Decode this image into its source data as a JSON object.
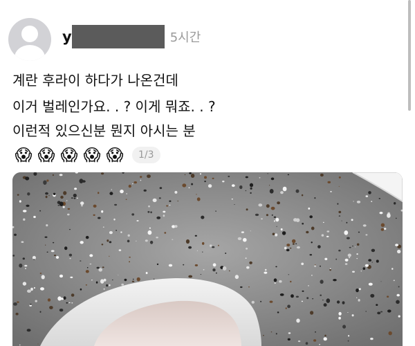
{
  "post": {
    "username_prefix": "y",
    "timestamp": "5시간",
    "lines": [
      "계란 후라이 하다가 나온건데",
      "이거 벌레인가요. . ? 이게 뭐죠. . ?",
      "이런적 있으신분 뭔지 아시는 분"
    ],
    "emojis": [
      "😱",
      "😱",
      "😱",
      "😱",
      "😱"
    ],
    "image_counter": "1/3"
  },
  "avatar": {
    "icon": "default-user-icon",
    "color": "#d2d2d6"
  },
  "photo": {
    "description_icon": "granite-countertop-eggshell-photo",
    "base_color": "#8f8f8f"
  }
}
